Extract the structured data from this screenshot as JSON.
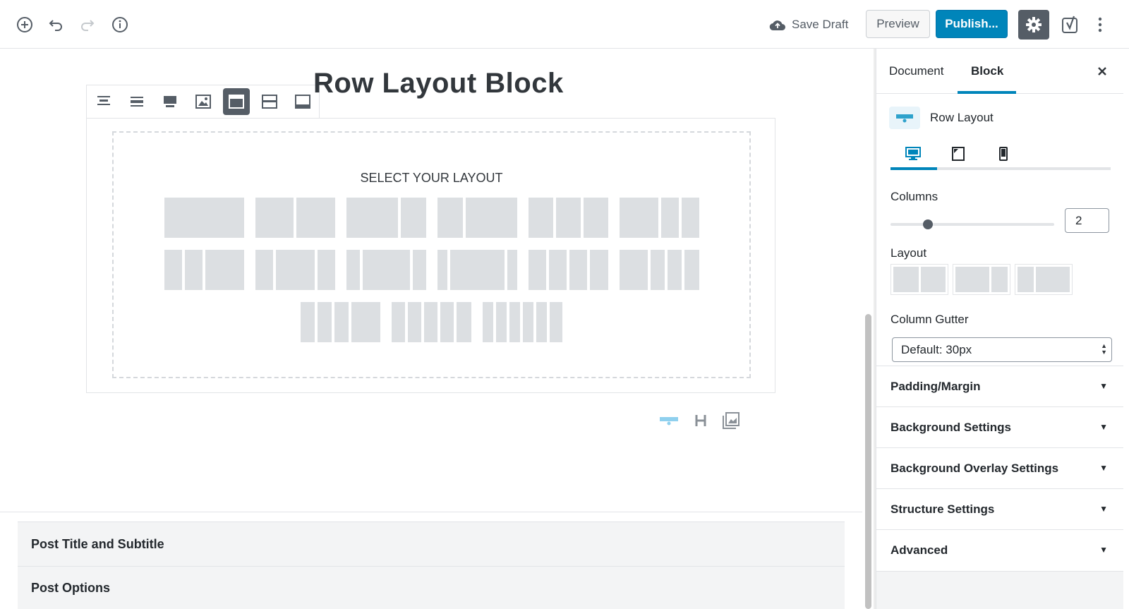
{
  "toolbar": {
    "add_icon": "plus-circle-icon",
    "undo_icon": "undo-icon",
    "redo_icon": "redo-icon",
    "info_icon": "info-icon",
    "save_draft_label": "Save Draft",
    "preview_label": "Preview",
    "publish_label": "Publish...",
    "accent": "#0085ba"
  },
  "editor": {
    "post_title": "Row Layout Block",
    "block_toolbar": [
      "align-top-icon",
      "align-center-icon",
      "align-bottom-icon",
      "image-icon",
      "wide-width-icon",
      "inner-width-icon",
      "full-width-icon"
    ],
    "select_layout_title": "SELECT YOUR LAYOUT",
    "inserter_icons": [
      "row-layout-icon",
      "heading-icon",
      "gallery-icon"
    ]
  },
  "meta_boxes": [
    "Post Title and Subtitle",
    "Post Options"
  ],
  "sidebar": {
    "tabs": [
      "Document",
      "Block"
    ],
    "active_tab": "Block",
    "block_name": "Row Layout",
    "device_tabs": [
      "desktop-icon",
      "tablet-icon",
      "mobile-icon"
    ],
    "columns_label": "Columns",
    "columns_value": "2",
    "layout_label": "Layout",
    "gutter_label": "Column Gutter",
    "gutter_value": "Default: 30px",
    "panels": [
      "Padding/Margin",
      "Background Settings",
      "Background Overlay Settings",
      "Structure Settings",
      "Advanced"
    ]
  }
}
